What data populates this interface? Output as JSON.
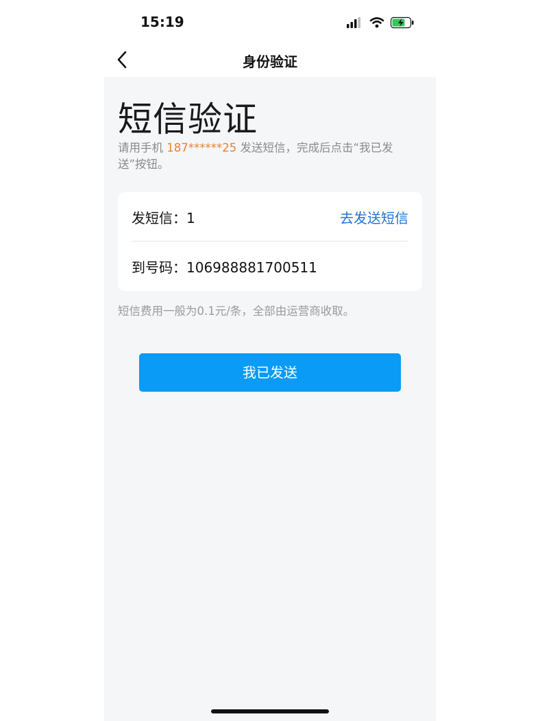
{
  "status_bar": {
    "time": "15:19"
  },
  "nav": {
    "title": "身份验证",
    "back_icon": "chevron-left-icon"
  },
  "main": {
    "heading": "短信验证",
    "instruction_prefix": "请用手机 ",
    "phone_masked": "187******25",
    "instruction_suffix": " 发送短信，完成后点击“我已发送”按钮。",
    "sms_content_label": "发短信：1",
    "send_sms_link": "去发送短信",
    "to_number_label": "到号码：106988881700511",
    "fee_note": "短信费用一般为0.1元/条，全部由运营商收取。",
    "confirm_button": "我已发送"
  },
  "colors": {
    "accent_blue": "#0a9bf7",
    "link_blue": "#1f73d6",
    "phone_orange": "#e8822a",
    "background_gray": "#f5f6f8"
  }
}
